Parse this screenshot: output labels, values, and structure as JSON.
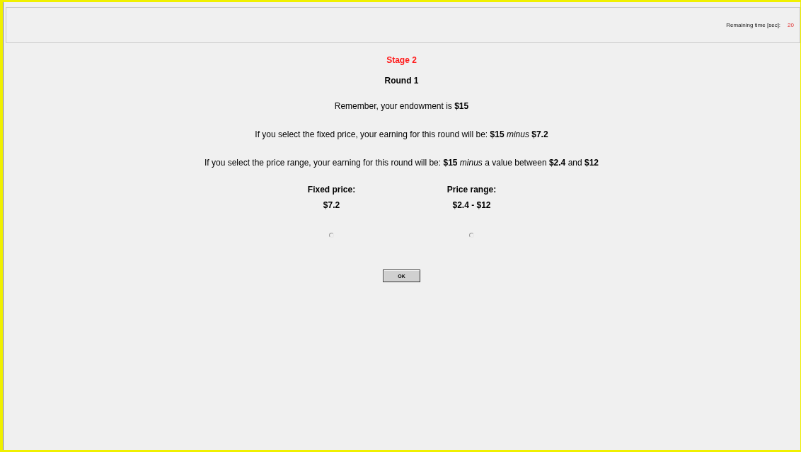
{
  "header": {
    "timer_label": "Remaining time [sec]:",
    "timer_value": "20"
  },
  "stage": "Stage 2",
  "round": "Round 1",
  "lines": [
    "Remember, your endowment is **$15**",
    "If you select the fixed price, your earning for this round will be: **$15** *minus* **$7.2**",
    "If you select the price range, your earning for this round will be: **$15** *minus* a value between **$2.4** and **$12**"
  ],
  "options": [
    {
      "label": "Fixed price:",
      "value": "$7.2",
      "selected": false
    },
    {
      "label": "Price range:",
      "value": "$2.4 - $12",
      "selected": false
    }
  ],
  "button": "OK"
}
